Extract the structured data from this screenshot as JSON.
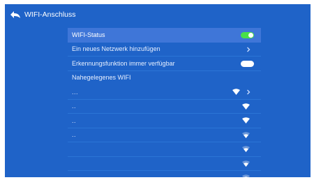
{
  "header": {
    "title": "WIFI-Anschluss"
  },
  "settings": {
    "wifi_status_label": "WIFI-Status",
    "add_network_label": "Ein neues Netzwerk hinzufügen",
    "scan_always_label": "Erkennungsfunktion immer verfügbar",
    "nearby_label": "Nahegelegenes WIFI"
  },
  "networks": [
    {
      "name": "...",
      "signal_level": 3,
      "has_chevron": true
    },
    {
      "name": "..",
      "signal_level": 3,
      "has_chevron": false
    },
    {
      "name": "..",
      "signal_level": 3,
      "has_chevron": false
    },
    {
      "name": "..",
      "signal_level": 2,
      "has_chevron": false
    },
    {
      "name": "",
      "signal_level": 2,
      "has_chevron": false
    },
    {
      "name": "",
      "signal_level": 2,
      "has_chevron": false
    },
    {
      "name": "",
      "signal_level": 2,
      "has_chevron": false
    }
  ],
  "colors": {
    "background": "#1f63c8",
    "highlight": "#3f76d8",
    "toggle_on": "#48e04a"
  },
  "icons": {
    "back": "back-arrow-icon",
    "wifi": "wifi-icon",
    "chevron": "chevron-right-icon"
  }
}
